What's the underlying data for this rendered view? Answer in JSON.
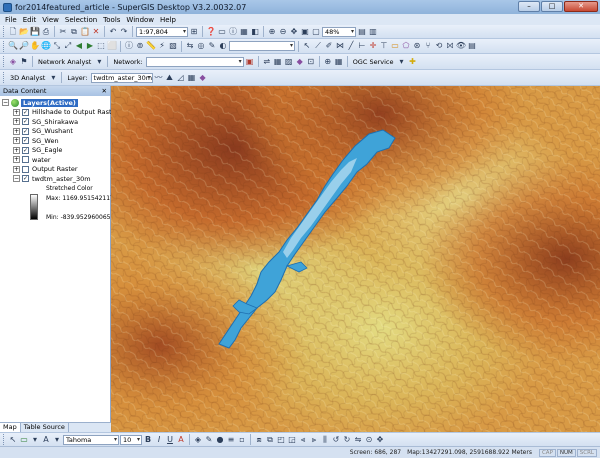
{
  "window": {
    "title": "for2014featured_article - SuperGIS Desktop V3.2.0032.07",
    "minimize": "–",
    "maximize": "□",
    "close": "✕"
  },
  "menu": [
    "File",
    "Edit",
    "View",
    "Selection",
    "Tools",
    "Window",
    "Help"
  ],
  "toolbar1": {
    "scale_value": "1:97,804",
    "zoom_value": "48%",
    "layer_combo": ""
  },
  "toolbar2": {},
  "toolbar3": {
    "network_analyst_label": "Network Analyst",
    "network_label": "Network:",
    "network_value": "",
    "ogc_service_label": "OGC Service"
  },
  "toolbar4": {
    "analyst_label": "3D Analyst",
    "layer_label": "Layer:",
    "layer_value": "twdtm_aster_30m"
  },
  "panel": {
    "title": "Data Content",
    "pin": "✕",
    "root_label": "Layers(Active)",
    "layers": [
      {
        "label": "Hillshade to Output Raster",
        "checked": true
      },
      {
        "label": "SG_Shirakawa",
        "checked": true
      },
      {
        "label": "SG_Wushant",
        "checked": true
      },
      {
        "label": "SG_Wen",
        "checked": true
      },
      {
        "label": "SG_Eagle",
        "checked": true
      },
      {
        "label": "water",
        "checked": false
      },
      {
        "label": "Output Raster",
        "checked": false
      },
      {
        "label": "twdtm_aster_30m",
        "checked": true
      }
    ],
    "legend_title": "Stretched Color",
    "legend_max": "Max: 1169.9515421173",
    "legend_min": "Min: -839.9529600657"
  },
  "tabs": [
    "Map",
    "Table Source"
  ],
  "drawbar": {
    "font_name": "Tahoma",
    "font_size": "10",
    "bold": "B",
    "italic": "I",
    "underline": "U",
    "text_tool": "A"
  },
  "status": {
    "screen": "Screen: 686, 287",
    "map": "Map:13427291.098, 2591688.922 Meters",
    "caps": "CAP",
    "num": "NUM",
    "scrl": "SCRL"
  },
  "colors": {
    "water": "#3fa3d8",
    "lowland": "#d9d870",
    "highland": "#a0522d"
  }
}
